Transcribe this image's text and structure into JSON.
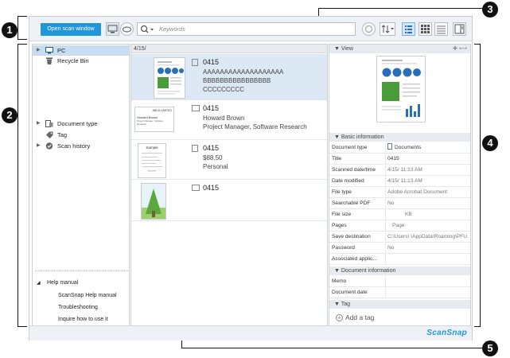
{
  "callouts": [
    "1",
    "2",
    "3",
    "4",
    "5"
  ],
  "toolbar": {
    "open_scan_label": "Open scan window",
    "search_placeholder": "Keywords"
  },
  "left_pane": {
    "tree_top": [
      {
        "label": "PC",
        "icon": "pc-icon",
        "arrow": "▶"
      },
      {
        "label": "Recycle Bin",
        "icon": "trash-icon",
        "arrow": ""
      }
    ],
    "tree_mid": [
      {
        "label": "Document type",
        "icon": "document-type-icon",
        "arrow": "▶"
      },
      {
        "label": "Tag",
        "icon": "tag-icon",
        "arrow": ""
      },
      {
        "label": "Scan history",
        "icon": "history-icon",
        "arrow": "▶"
      }
    ],
    "help": {
      "title": "Help manual",
      "arrow": "◢",
      "items": [
        "ScanSnap Help manual",
        "Troubleshooting",
        "Inquire how to use it"
      ]
    }
  },
  "middle_pane": {
    "header": "4/15/",
    "items": [
      {
        "title": "0415",
        "lines": [
          "AAAAAAAAAAAAAAAAAAA",
          "BBBBBBBBBBBBBBBB",
          "CCCCCCCCC"
        ],
        "kind": "document"
      },
      {
        "title": "0415",
        "lines": [
          "Howard Brown",
          "Project Manager, Software Research"
        ],
        "kind": "business-card"
      },
      {
        "title": "0415",
        "lines": [
          "$88.50",
          "Personal"
        ],
        "kind": "receipt"
      },
      {
        "title": "0415",
        "lines": [],
        "kind": "photo"
      }
    ],
    "card_thumb": {
      "company": "ABCD LIMITED",
      "name": "Howard Brown",
      "role": "Project Manager, Software Research"
    },
    "receipt_thumb": {
      "title": "Sample"
    }
  },
  "right_pane": {
    "view_title": "View",
    "basic_title": "Basic information",
    "basic": [
      {
        "key": "Document type",
        "value": "Documents"
      },
      {
        "key": "Title",
        "value": "0415"
      },
      {
        "key": "Scanned date/time",
        "value": "4/15/     11:13 AM"
      },
      {
        "key": "Date modified",
        "value": "4/15/     11:13 AM"
      },
      {
        "key": "File type",
        "value": "Adobe Acrobat Document"
      },
      {
        "key": "Searchable PDF",
        "value": "No"
      },
      {
        "key": "File size",
        "value": "KB"
      },
      {
        "key": "Pages",
        "value": "Page"
      },
      {
        "key": "Save destination",
        "value": "C:\\Users\\     \\AppData\\Roaming\\PFU..."
      },
      {
        "key": "Password",
        "value": "No"
      },
      {
        "key": "Associated applic...",
        "value": ""
      }
    ],
    "doc_info_title": "Document information",
    "doc_info": [
      {
        "key": "Memo",
        "value": ""
      },
      {
        "key": "Document date",
        "value": ""
      }
    ],
    "tag_title": "Tag",
    "add_tag_label": "Add a tag"
  },
  "status_bar": {
    "brand": "ScanSnap"
  },
  "colors": {
    "accent": "#1f97d8",
    "selection": "#c8ddf4"
  }
}
